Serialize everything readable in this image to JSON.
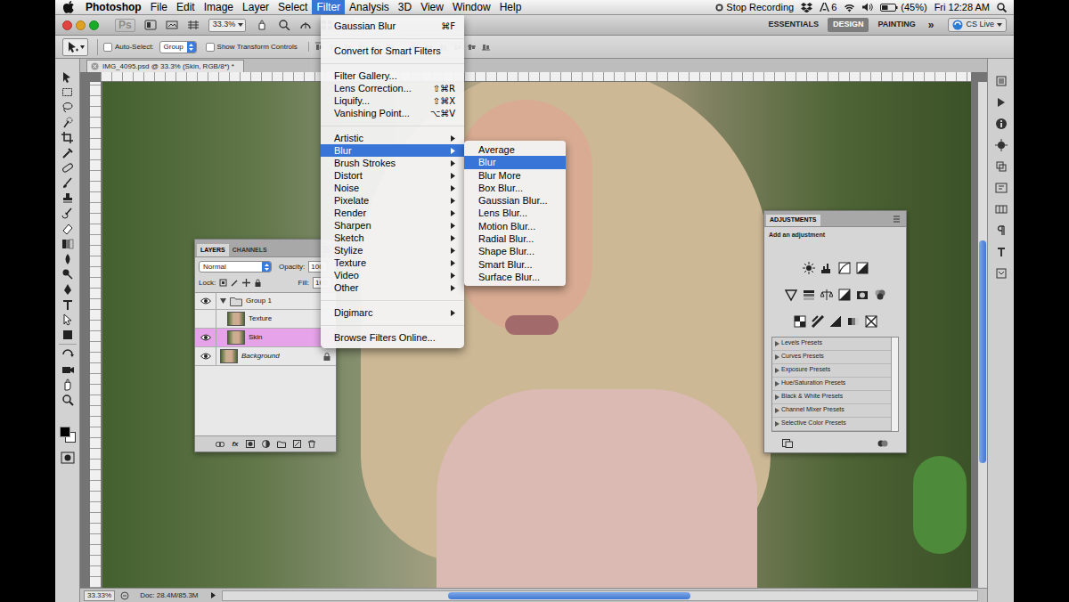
{
  "menubar": {
    "items": [
      {
        "label": "Photoshop",
        "selected": false
      },
      {
        "label": "File",
        "selected": false
      },
      {
        "label": "Edit",
        "selected": false
      },
      {
        "label": "Image",
        "selected": false
      },
      {
        "label": "Layer",
        "selected": false
      },
      {
        "label": "Select",
        "selected": false
      },
      {
        "label": "Filter",
        "selected": true
      },
      {
        "label": "Analysis",
        "selected": false
      },
      {
        "label": "3D",
        "selected": false
      },
      {
        "label": "View",
        "selected": false
      },
      {
        "label": "Window",
        "selected": false
      },
      {
        "label": "Help",
        "selected": false
      }
    ],
    "extras": {
      "recording": "Stop Recording",
      "adobe_count": "6",
      "battery": "(45%)",
      "clock": "Fri 12:28 AM"
    }
  },
  "app_bar": {
    "logo": "Ps",
    "zoom": "33.3%",
    "workspaces": [
      {
        "label": "ESSENTIALS",
        "selected": false
      },
      {
        "label": "DESIGN",
        "selected": true
      },
      {
        "label": "PAINTING",
        "selected": false
      }
    ],
    "overflow": "»",
    "cs_live": "CS Live"
  },
  "options_bar": {
    "auto_select": {
      "label": "Auto-Select:",
      "checked": false
    },
    "target": "Group",
    "transform_controls": {
      "label": "Show Transform Controls",
      "checked": false
    }
  },
  "document": {
    "tab": "IMG_4095.psd @ 33.3% (Skin, RGB/8*) *"
  },
  "status_bar": {
    "zoom": "33.33%",
    "doc": "Doc: 28.4M/85.3M"
  },
  "layers_panel": {
    "tabs": [
      {
        "label": "LAYERS",
        "selected": true
      },
      {
        "label": "CHANNELS",
        "selected": false
      }
    ],
    "blend_mode": "Normal",
    "opacity_label": "Opacity:",
    "opacity": "100",
    "lock_label": "Lock:",
    "fill_label": "Fill:",
    "fill": "100",
    "layers": [
      {
        "name": "Group 1",
        "kind": "group",
        "visible": true,
        "expanded": true,
        "in_group": false,
        "selected": false,
        "locked": false
      },
      {
        "name": "Texture",
        "kind": "layer",
        "visible": false,
        "expanded": false,
        "in_group": true,
        "selected": false,
        "locked": false
      },
      {
        "name": "Skin",
        "kind": "layer",
        "visible": true,
        "expanded": false,
        "in_group": true,
        "selected": true,
        "locked": false
      },
      {
        "name": "Background",
        "kind": "layer",
        "visible": true,
        "expanded": false,
        "in_group": false,
        "selected": false,
        "locked": true
      }
    ],
    "footer_fx": "fx"
  },
  "adjustments_panel": {
    "title": "ADJUSTMENTS",
    "subtitle": "Add an adjustment",
    "presets": [
      {
        "label": "Levels Presets",
        "expanded": false
      },
      {
        "label": "Curves Presets",
        "expanded": false
      },
      {
        "label": "Exposure Presets",
        "expanded": false
      },
      {
        "label": "Hue/Saturation Presets",
        "expanded": false
      },
      {
        "label": "Black & White Presets",
        "expanded": false
      },
      {
        "label": "Channel Mixer Presets",
        "expanded": false
      },
      {
        "label": "Selective Color Presets",
        "expanded": false
      }
    ]
  },
  "filter_menu": {
    "items": [
      {
        "kind": "item",
        "label": "Gaussian Blur",
        "shortcut": "⌘F",
        "has_submenu": false,
        "selected": false
      },
      {
        "kind": "separator"
      },
      {
        "kind": "item",
        "label": "Convert for Smart Filters",
        "has_submenu": false,
        "selected": false
      },
      {
        "kind": "separator"
      },
      {
        "kind": "item",
        "label": "Filter Gallery...",
        "has_submenu": false,
        "selected": false
      },
      {
        "kind": "item",
        "label": "Lens Correction...",
        "shortcut": "⇧⌘R",
        "has_submenu": false,
        "selected": false
      },
      {
        "kind": "item",
        "label": "Liquify...",
        "shortcut": "⇧⌘X",
        "has_submenu": false,
        "selected": false
      },
      {
        "kind": "item",
        "label": "Vanishing Point...",
        "shortcut": "⌥⌘V",
        "has_submenu": false,
        "selected": false
      },
      {
        "kind": "separator"
      },
      {
        "kind": "item",
        "label": "Artistic",
        "has_submenu": true,
        "selected": false
      },
      {
        "kind": "item",
        "label": "Blur",
        "has_submenu": true,
        "selected": true
      },
      {
        "kind": "item",
        "label": "Brush Strokes",
        "has_submenu": true,
        "selected": false
      },
      {
        "kind": "item",
        "label": "Distort",
        "has_submenu": true,
        "selected": false
      },
      {
        "kind": "item",
        "label": "Noise",
        "has_submenu": true,
        "selected": false
      },
      {
        "kind": "item",
        "label": "Pixelate",
        "has_submenu": true,
        "selected": false
      },
      {
        "kind": "item",
        "label": "Render",
        "has_submenu": true,
        "selected": false
      },
      {
        "kind": "item",
        "label": "Sharpen",
        "has_submenu": true,
        "selected": false
      },
      {
        "kind": "item",
        "label": "Sketch",
        "has_submenu": true,
        "selected": false
      },
      {
        "kind": "item",
        "label": "Stylize",
        "has_submenu": true,
        "selected": false
      },
      {
        "kind": "item",
        "label": "Texture",
        "has_submenu": true,
        "selected": false
      },
      {
        "kind": "item",
        "label": "Video",
        "has_submenu": true,
        "selected": false
      },
      {
        "kind": "item",
        "label": "Other",
        "has_submenu": true,
        "selected": false
      },
      {
        "kind": "separator"
      },
      {
        "kind": "item",
        "label": "Digimarc",
        "has_submenu": true,
        "selected": false
      },
      {
        "kind": "separator"
      },
      {
        "kind": "item",
        "label": "Browse Filters Online...",
        "has_submenu": false,
        "selected": false
      }
    ]
  },
  "blur_submenu": {
    "items": [
      {
        "label": "Average",
        "selected": false
      },
      {
        "label": "Blur",
        "selected": true
      },
      {
        "label": "Blur More",
        "selected": false
      },
      {
        "label": "Box Blur...",
        "selected": false
      },
      {
        "label": "Gaussian Blur...",
        "selected": false
      },
      {
        "label": "Lens Blur...",
        "selected": false
      },
      {
        "label": "Motion Blur...",
        "selected": false
      },
      {
        "label": "Radial Blur...",
        "selected": false
      },
      {
        "label": "Shape Blur...",
        "selected": false
      },
      {
        "label": "Smart Blur...",
        "selected": false
      },
      {
        "label": "Surface Blur...",
        "selected": false
      }
    ]
  }
}
